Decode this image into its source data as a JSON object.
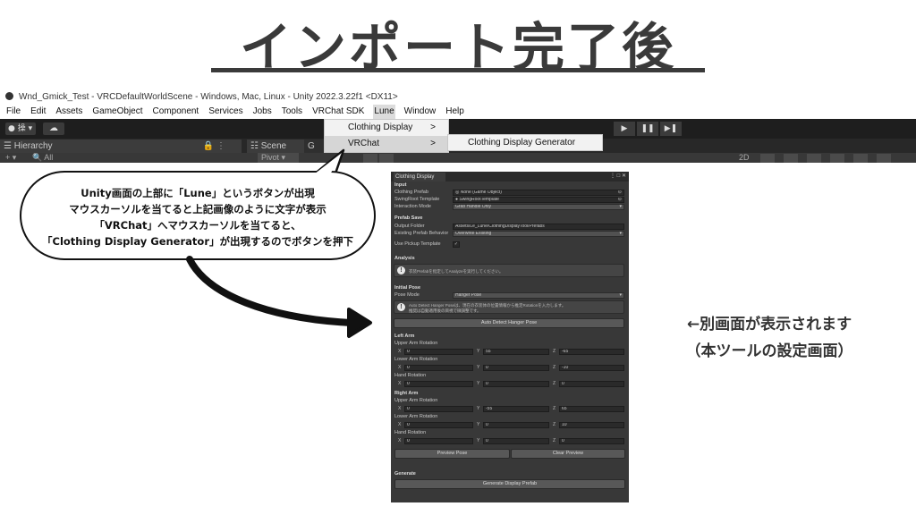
{
  "title": "インポート完了後",
  "window": {
    "title": "Wnd_Gmick_Test - VRCDefaultWorldScene - Windows, Mac, Linux - Unity 2022.3.22f1 <DX11>"
  },
  "menu": [
    "File",
    "Edit",
    "Assets",
    "GameObject",
    "Component",
    "Services",
    "Jobs",
    "Tools",
    "VRChat SDK",
    "Lune",
    "Window",
    "Help"
  ],
  "toolbar": {
    "account_label": "● 操 ▾",
    "cloud_icon": "☁",
    "play_icons": [
      "▶",
      "❚❚",
      "▶❚"
    ]
  },
  "panels": {
    "hierarchy_tab": "Hierarchy",
    "scene_tab": "Scene",
    "game_tab": "G",
    "search_placeholder": "All",
    "pivot": "Pivot ▾",
    "zoom": "2D",
    "hier_lock": "🔒 ⋮"
  },
  "dropdown": {
    "items": [
      {
        "label": "Clothing Display",
        "arrow": ">"
      },
      {
        "label": "VRChat",
        "arrow": ">"
      }
    ],
    "submenu_item": "Clothing Display Generator"
  },
  "bubble": {
    "lines": [
      "Unity画面の上部に「Lune」というボタンが出現",
      "マウスカーソルを当てると上記画像のように文字が表示",
      "「VRChat」へマウスカーソルを当てると、",
      "「Clothing Display Generator」が出現するのでボタンを押下"
    ]
  },
  "inspector": {
    "tab": "Clothing Display",
    "controls": "⋮ □ ✕",
    "input": {
      "header": "Input",
      "clothing_prefab_label": "Clothing Prefab",
      "clothing_prefab_value": "None (Game Object)",
      "swingroot_label": "SwingRoot Template",
      "swingroot_value": "SwingRootTemplate",
      "interaction_label": "Interaction Mode",
      "interaction_value": "Grab Handle Only"
    },
    "prefab_save": {
      "header": "Prefab Save",
      "output_label": "Output Folder",
      "output_value": "Assets/Le_Lune/ClothingDisplayTool/Prefabs",
      "existing_label": "Existing Prefab Behavior",
      "existing_value": "Overwrite Existing",
      "pickup_label": "Use Pickup Template",
      "pickup_check": "✓"
    },
    "analysis": {
      "header": "Analysis",
      "help": "衣装Prefabを指定してAnalyzeを実行してください。"
    },
    "initial_pose": {
      "header": "Initial Pose",
      "pose_label": "Pose Mode",
      "pose_value": "Hanger Pose",
      "help_line1": "Auto Detect Hanger Poseは、現在の衣装体の位置情報から推定Rotationを入力します。",
      "help_line2": "推奨は自動適用後の目視で微調整です。",
      "auto_btn": "Auto Detect Hanger Pose"
    },
    "left_arm": {
      "header": "Left Arm",
      "upper": {
        "label": "Upper Arm Rotation",
        "x": "0",
        "y": "55",
        "z": "-65"
      },
      "lower": {
        "label": "Lower Arm Rotation",
        "x": "0",
        "y": "0",
        "z": "-10"
      },
      "hand": {
        "label": "Hand Rotation",
        "x": "0",
        "y": "0",
        "z": "0"
      }
    },
    "right_arm": {
      "header": "Right Arm",
      "upper": {
        "label": "Upper Arm Rotation",
        "x": "0",
        "y": "-55",
        "z": "65"
      },
      "lower": {
        "label": "Lower Arm Rotation",
        "x": "0",
        "y": "0",
        "z": "10"
      },
      "hand": {
        "label": "Hand Rotation",
        "x": "0",
        "y": "0",
        "z": "0"
      }
    },
    "axis": {
      "x": "X",
      "y": "Y",
      "z": "Z"
    },
    "preview_btn": "Preview Pose",
    "clear_btn": "Clear Preview",
    "generate": {
      "header": "Generate",
      "btn": "Generate Display Prefab"
    }
  },
  "note": {
    "line1": "←別画面が表示されます",
    "line2": "（本ツールの設定画面）"
  }
}
